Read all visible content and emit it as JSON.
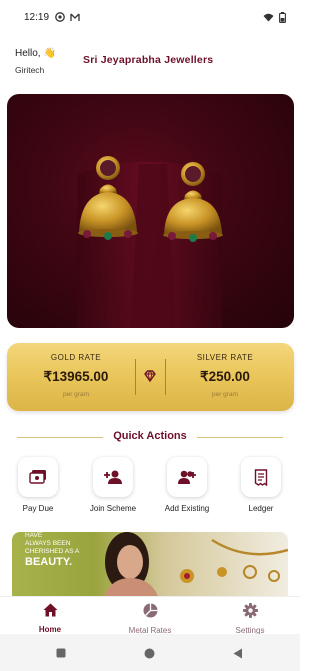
{
  "status_bar": {
    "time": "12:19",
    "left_icons": [
      "whatsapp-icon",
      "gmail-icon"
    ],
    "right_icons": [
      "wifi-icon",
      "battery-icon"
    ]
  },
  "header": {
    "greeting": "Hello,",
    "greeting_emoji": "👋",
    "username": "Giritech",
    "store_name": "Sri Jeyaprabha Jewellers"
  },
  "hero": {
    "image": "gold-jhumka-earrings-on-velvet-stand"
  },
  "rates": {
    "gold_label": "GOLD RATE",
    "gold_value": "₹13965.00",
    "gold_unit": "per gram",
    "silver_label": "SILVER RATE",
    "silver_value": "₹250.00",
    "silver_unit": "per gram",
    "icon": "gem-icon"
  },
  "quick_actions": {
    "title": "Quick Actions",
    "items": [
      {
        "label": "Pay Due",
        "icon": "payment-icon"
      },
      {
        "label": "Join Scheme",
        "icon": "add-person-icon"
      },
      {
        "label": "Add Existing",
        "icon": "group-add-icon"
      },
      {
        "label": "Ledger",
        "icon": "receipt-icon"
      }
    ]
  },
  "banner": {
    "line1": "HAVE",
    "line2": "ALWAYS BEEN",
    "line3": "CHERISHED AS A",
    "line4": "BEAUTY."
  },
  "bottom_nav": {
    "items": [
      {
        "label": "Home",
        "icon": "home-icon",
        "active": true
      },
      {
        "label": "Metal Rates",
        "icon": "pie-chart-icon",
        "active": false
      },
      {
        "label": "Settings",
        "icon": "gear-icon",
        "active": false
      }
    ]
  },
  "colors": {
    "brand": "#6e1028",
    "gold_card": "#e9c55a",
    "hero_bg": "#3d0612"
  }
}
